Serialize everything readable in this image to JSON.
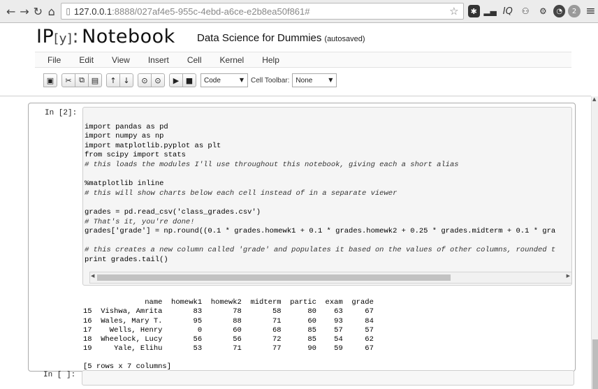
{
  "browser": {
    "url_host": "127.0.0.1",
    "url_path": ":8888/027af4e5-955c-4ebd-a6ce-e2b8ea50f861#",
    "extensions": [
      "star-icon",
      "puzzle-icon",
      "signal-icon",
      "IQ",
      "person-icon",
      "gear-icon",
      "circle-icon",
      "2",
      "menu-icon"
    ],
    "ext_badge": "2",
    "ext_iq": "IQ"
  },
  "notebook": {
    "logo_main": "IP",
    "logo_bracket": "[y]",
    "logo_sep": ":",
    "logo_rest": "Notebook",
    "title": "Data Science for Dummies",
    "save_status": "(autosaved)"
  },
  "menu": {
    "items": [
      "File",
      "Edit",
      "View",
      "Insert",
      "Cell",
      "Kernel",
      "Help"
    ]
  },
  "toolbar": {
    "cell_type": "Code",
    "cell_toolbar_label": "Cell Toolbar:",
    "cell_toolbar_value": "None"
  },
  "cells": [
    {
      "prompt": "In [2]:",
      "code_lines": [
        "import pandas as pd",
        "import numpy as np",
        "import matplotlib.pyplot as plt",
        "from scipy import stats",
        "# this loads the modules I'll use throughout this notebook, giving each a short alias",
        "",
        "%matplotlib inline",
        "# this will show charts below each cell instead of in a separate viewer",
        "",
        "grades = pd.read_csv('class_grades.csv')",
        "# That's it, you're done!",
        "grades['grade'] = np.round((0.1 * grades.homewk1 + 0.1 * grades.homewk2 + 0.25 * grades.midterm + 0.1 * gra",
        "",
        "# this creates a new column called 'grade' and populates it based on the values of other columns, rounded t",
        "print grades.tail()"
      ],
      "output": {
        "header": "              name  homewk1  homewk2  midterm  partic  exam  grade",
        "rows": [
          "15  Vishwa, Amrita       83       78       58      80    63     67",
          "16  Wales, Mary T.       95       88       71      60    93     84",
          "17    Wells, Henry        0       60       68      85    57     57",
          "18  Wheelock, Lucy       56       56       72      85    54     62",
          "19     Yale, Elihu       53       71       77      90    59     67"
        ],
        "summary": "[5 rows x 7 columns]"
      }
    },
    {
      "prompt": "In [ ]:"
    }
  ]
}
